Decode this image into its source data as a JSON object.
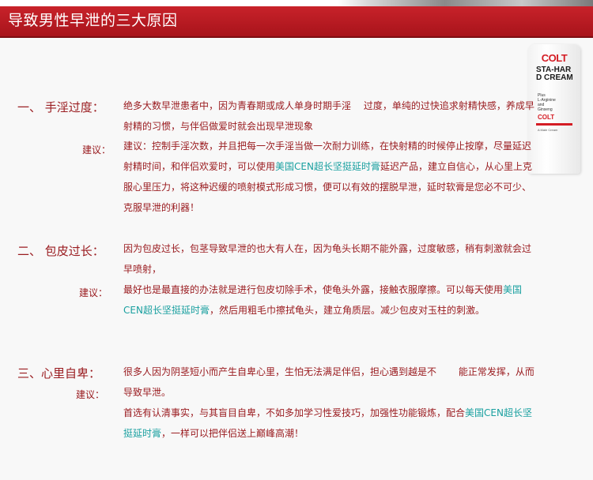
{
  "header": {
    "title": "导致男性早泄的三大原因"
  },
  "product": {
    "brand": "COLT",
    "name": "STA-HARD CREAM",
    "sub": "Plus\nL-Arginine\nand\nGinseng",
    "brand2": "COLT",
    "small": "A Male Cream"
  },
  "colors": {
    "header_red": "#b51a21",
    "text_red": "#9a1c20",
    "highlight_teal": "#1aa0a0"
  },
  "sections": [
    {
      "label": "一、 手淫过度：",
      "text": "绝多大数早泄患者中，因为青春期或成人单身时期手淫　 过度，单纯的过快追求射精快感，养成早射精的习惯，与伴侣做爱时就会出现早泄现象",
      "advice_label": "建议：",
      "advice_pre": "建议：控制手淫次数，并且把每一次手淫当做一次耐力训练，在快射精的时候停止按摩，尽量延迟射精时间，和伴侣欢爱时，可以使用",
      "advice_product": "美国CEN超长坚挺延时膏",
      "advice_post": "延迟产品，建立自信心，从心里上克服心里压力，将这种迟缓的喷射模式形成习惯，便可以有效的摆脱早泄，延时软膏是您必不可少、克服早泄的利器！"
    },
    {
      "label": "二、 包皮过长：",
      "text": "因为包皮过长，包茎导致早泄的也大有人在，因为龟头长期不能外露，过度敏感，稍有刺激就会过早喷射，",
      "advice_label": "建议：",
      "advice_pre": "最好也是最直接的办法就是进行包皮切除手术，使龟头外露，接触衣服摩擦。可以每天使用",
      "advice_product": "美国CEN超长坚挺延时膏",
      "advice_post": "，然后用粗毛巾擦拭龟头，建立角质层。减少包皮对玉柱的刺激。"
    },
    {
      "label": "三、心里自卑：",
      "text": "很多人因为阴茎短小而产生自卑心里，生怕无法满足伴侣，担心遇到越是不　　 能正常发挥，从而导致早泄。",
      "advice_label": "建议：",
      "advice_pre": "首选有认清事实，与其盲目自卑，不如多加学习性爱技巧，加强性功能锻炼，配合",
      "advice_product": "美国CEN超长坚挺延时膏",
      "advice_post": "，一样可以把伴侣送上巅峰高潮！"
    }
  ]
}
